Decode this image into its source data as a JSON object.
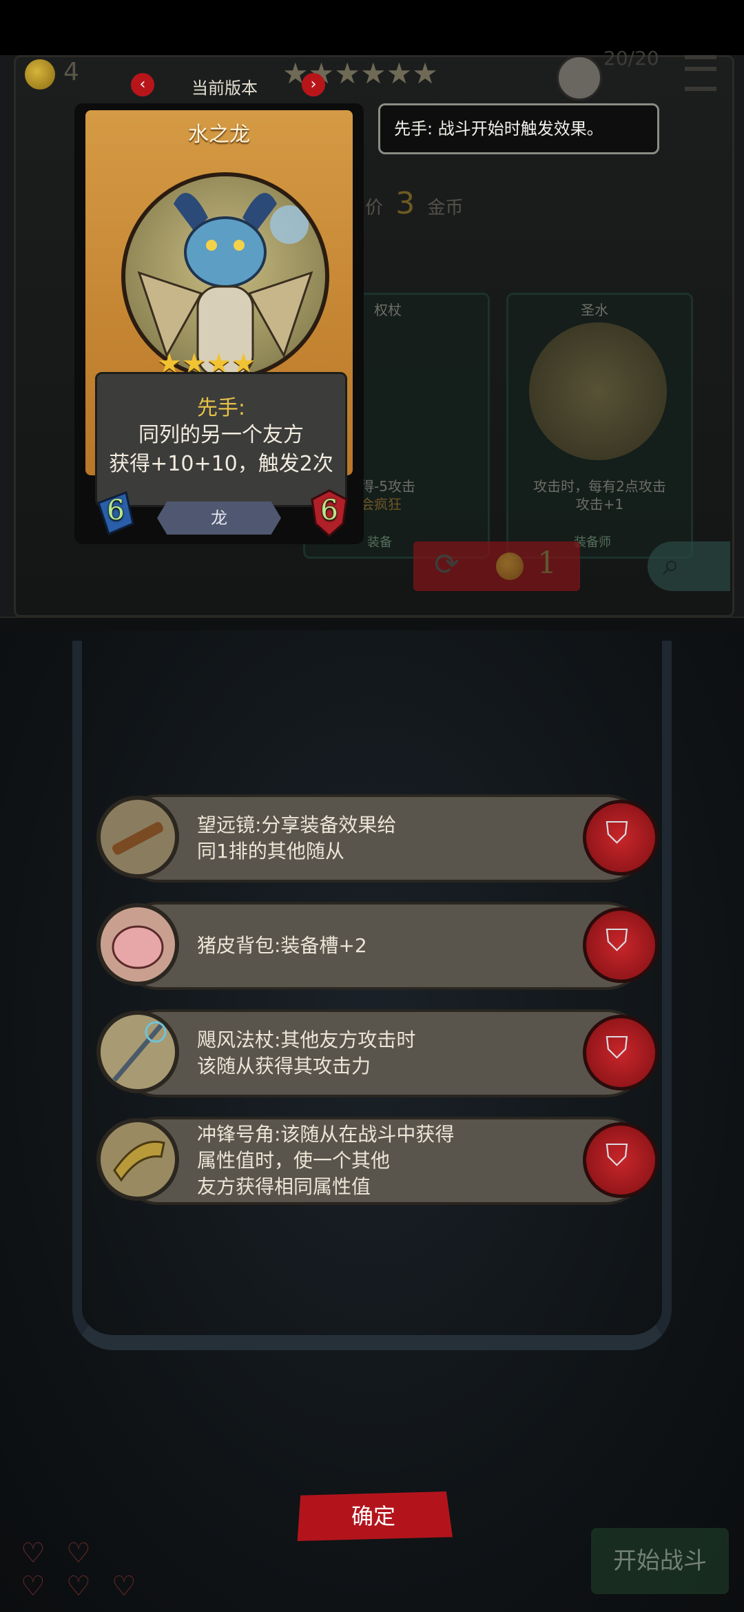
{
  "top_bar": {
    "coins": "4",
    "version_label": "当前版本",
    "counter": "20/20"
  },
  "tooltip": {
    "text": "先手: 战斗开始时触发效果。"
  },
  "card": {
    "name": "水之龙",
    "stars": 4,
    "keyword": "先手:",
    "description_line1": "同列的另一个友方",
    "description_line2": "获得+10+10，触发2次",
    "tribe": "龙",
    "attack": "6",
    "health": "6"
  },
  "shop": {
    "price_prefix": "价",
    "price": "3",
    "price_unit": "金币",
    "bg_card_left": {
      "title": "权杖",
      "desc_line1": "得-5攻击",
      "desc_line2": "会疯狂",
      "tag": "装备"
    },
    "bg_card_right": {
      "title": "圣水",
      "desc_line1": "攻击时，每有2点攻击",
      "desc_line2": "攻击+1",
      "tag": "装备师"
    },
    "refresh_cost": "1"
  },
  "equipment": [
    {
      "text": "望远镜:分享装备效果给\n同1排的其他随从",
      "icon": "telescope-icon"
    },
    {
      "text": "猪皮背包:装备槽+2",
      "icon": "pig-backpack-icon"
    },
    {
      "text": "飓风法杖:其他友方攻击时\n该随从获得其攻击力",
      "icon": "hurricane-staff-icon"
    },
    {
      "text": "冲锋号角:该随从在战斗中获得\n属性值时，使一个其他\n友方获得相同属性值",
      "icon": "charge-horn-icon"
    }
  ],
  "buttons": {
    "confirm": "确定",
    "start_battle": "开始战斗"
  },
  "colors": {
    "accent_red": "#b3141c",
    "card_wood": "#c98a36",
    "keyword_gold": "#e8c24a"
  }
}
